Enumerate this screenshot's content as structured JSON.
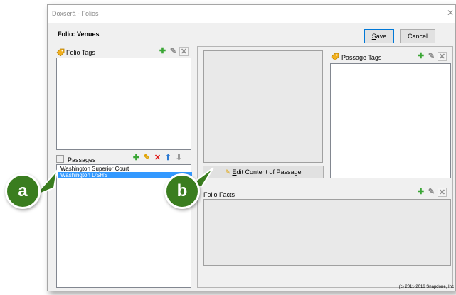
{
  "window": {
    "title": "Doxserá - Folios"
  },
  "folio": {
    "title": "Folio: Venues"
  },
  "buttons": {
    "save": "Save",
    "save_mnemonic": "S",
    "cancel": "Cancel"
  },
  "folio_tags": {
    "label": "Folio Tags"
  },
  "passages": {
    "label": "Passages",
    "items": [
      {
        "label": "Washington Superior Court",
        "selected": false
      },
      {
        "label": "Washington DSHS",
        "selected": true
      }
    ]
  },
  "edit_button": {
    "label": "Edit Content of Passage",
    "mnemonic": "E"
  },
  "passage_tags": {
    "label": "Passage Tags"
  },
  "folio_facts": {
    "label": "Folio Facts"
  },
  "callouts": {
    "a": "a",
    "b": "b"
  },
  "footer": {
    "copyright": "(c) 2011-2016 Snapdone, Inc"
  },
  "colors": {
    "callout": "#3a7d1f",
    "selection": "#3399ff"
  },
  "icons": [
    "tag-icon",
    "add-icon",
    "edit-icon",
    "delete-icon",
    "move-up-icon",
    "move-down-icon",
    "passage-icon",
    "pencil-icon",
    "close-icon"
  ]
}
